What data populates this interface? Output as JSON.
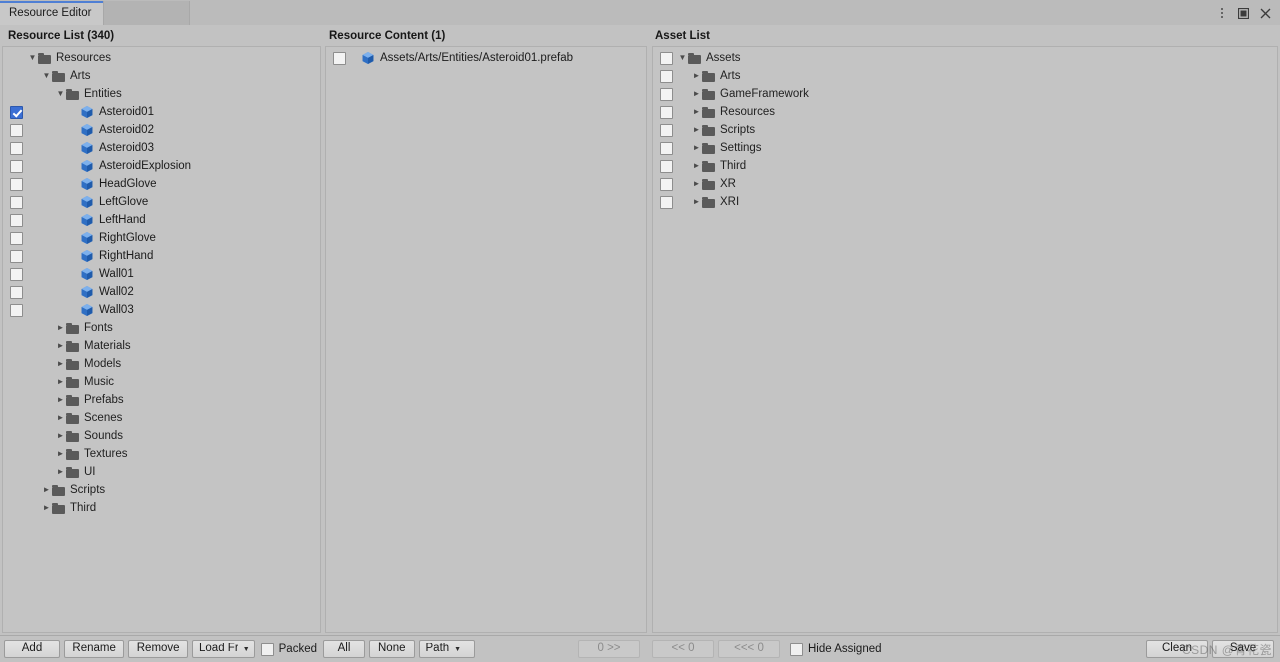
{
  "window": {
    "tab_label": "Resource Editor",
    "controls": {
      "menu": "kebab-menu-icon",
      "maximize": "maximize-icon",
      "close": "close-icon"
    }
  },
  "columns": {
    "resource_list_title": "Resource List (340)",
    "resource_content_title": "Resource Content (1)",
    "asset_list_title": "Asset List"
  },
  "resource_list": {
    "items": [
      {
        "label": "Resources",
        "type": "folder",
        "depth": 0,
        "expanded": true,
        "checkbox": "none"
      },
      {
        "label": "Arts",
        "type": "folder",
        "depth": 1,
        "expanded": true,
        "checkbox": "none"
      },
      {
        "label": "Entities",
        "type": "folder",
        "depth": 2,
        "expanded": true,
        "checkbox": "none"
      },
      {
        "label": "Asteroid01",
        "type": "prefab",
        "depth": 3,
        "expanded": null,
        "checkbox": "checked"
      },
      {
        "label": "Asteroid02",
        "type": "prefab",
        "depth": 3,
        "expanded": null,
        "checkbox": "unchecked"
      },
      {
        "label": "Asteroid03",
        "type": "prefab",
        "depth": 3,
        "expanded": null,
        "checkbox": "unchecked"
      },
      {
        "label": "AsteroidExplosion",
        "type": "prefab",
        "depth": 3,
        "expanded": null,
        "checkbox": "unchecked"
      },
      {
        "label": "HeadGlove",
        "type": "prefab",
        "depth": 3,
        "expanded": null,
        "checkbox": "unchecked"
      },
      {
        "label": "LeftGlove",
        "type": "prefab",
        "depth": 3,
        "expanded": null,
        "checkbox": "unchecked"
      },
      {
        "label": "LeftHand",
        "type": "prefab",
        "depth": 3,
        "expanded": null,
        "checkbox": "unchecked"
      },
      {
        "label": "RightGlove",
        "type": "prefab",
        "depth": 3,
        "expanded": null,
        "checkbox": "unchecked"
      },
      {
        "label": "RightHand",
        "type": "prefab",
        "depth": 3,
        "expanded": null,
        "checkbox": "unchecked"
      },
      {
        "label": "Wall01",
        "type": "prefab",
        "depth": 3,
        "expanded": null,
        "checkbox": "unchecked"
      },
      {
        "label": "Wall02",
        "type": "prefab",
        "depth": 3,
        "expanded": null,
        "checkbox": "unchecked"
      },
      {
        "label": "Wall03",
        "type": "prefab",
        "depth": 3,
        "expanded": null,
        "checkbox": "unchecked"
      },
      {
        "label": "Fonts",
        "type": "folder",
        "depth": 2,
        "expanded": false,
        "checkbox": "none"
      },
      {
        "label": "Materials",
        "type": "folder",
        "depth": 2,
        "expanded": false,
        "checkbox": "none"
      },
      {
        "label": "Models",
        "type": "folder",
        "depth": 2,
        "expanded": false,
        "checkbox": "none"
      },
      {
        "label": "Music",
        "type": "folder",
        "depth": 2,
        "expanded": false,
        "checkbox": "none"
      },
      {
        "label": "Prefabs",
        "type": "folder",
        "depth": 2,
        "expanded": false,
        "checkbox": "none"
      },
      {
        "label": "Scenes",
        "type": "folder",
        "depth": 2,
        "expanded": false,
        "checkbox": "none"
      },
      {
        "label": "Sounds",
        "type": "folder",
        "depth": 2,
        "expanded": false,
        "checkbox": "none"
      },
      {
        "label": "Textures",
        "type": "folder",
        "depth": 2,
        "expanded": false,
        "checkbox": "none"
      },
      {
        "label": "UI",
        "type": "folder",
        "depth": 2,
        "expanded": false,
        "checkbox": "none"
      },
      {
        "label": "Scripts",
        "type": "folder",
        "depth": 1,
        "expanded": false,
        "checkbox": "none"
      },
      {
        "label": "Third",
        "type": "folder",
        "depth": 1,
        "expanded": false,
        "checkbox": "none"
      }
    ]
  },
  "resource_content": {
    "items": [
      {
        "label": "Assets/Arts/Entities/Asteroid01.prefab",
        "type": "prefab",
        "depth": 0,
        "expanded": null,
        "checkbox": "unchecked"
      }
    ]
  },
  "asset_list": {
    "items": [
      {
        "label": "Assets",
        "type": "folder",
        "depth": 0,
        "expanded": true,
        "checkbox": "unchecked"
      },
      {
        "label": "Arts",
        "type": "folder",
        "depth": 1,
        "expanded": false,
        "checkbox": "unchecked"
      },
      {
        "label": "GameFramework",
        "type": "folder",
        "depth": 1,
        "expanded": false,
        "checkbox": "unchecked"
      },
      {
        "label": "Resources",
        "type": "folder",
        "depth": 1,
        "expanded": false,
        "checkbox": "unchecked"
      },
      {
        "label": "Scripts",
        "type": "folder",
        "depth": 1,
        "expanded": false,
        "checkbox": "unchecked"
      },
      {
        "label": "Settings",
        "type": "folder",
        "depth": 1,
        "expanded": false,
        "checkbox": "unchecked"
      },
      {
        "label": "Third",
        "type": "folder",
        "depth": 1,
        "expanded": false,
        "checkbox": "unchecked"
      },
      {
        "label": "XR",
        "type": "folder",
        "depth": 1,
        "expanded": false,
        "checkbox": "unchecked"
      },
      {
        "label": "XRI",
        "type": "folder",
        "depth": 1,
        "expanded": false,
        "checkbox": "unchecked"
      }
    ]
  },
  "toolbar": {
    "add_label": "Add",
    "rename_label": "Rename",
    "remove_label": "Remove",
    "load_from_label": "Load Fror",
    "packed_label": "Packed",
    "packed_checked": false,
    "all_label": "All",
    "none_label": "None",
    "path_label": "Path",
    "forward_label": "0 >>",
    "back_label": "<< 0",
    "back_all_label": "<<< 0",
    "hide_assigned_label": "Hide Assigned",
    "hide_assigned_checked": false,
    "clean_label": "Clean",
    "save_label": "Save"
  },
  "watermark": {
    "text": "CSDN @青花瓷"
  },
  "colors": {
    "accent": "#3b6fd4",
    "prefab_icon": "#3f7fd6",
    "folder_icon": "#5a5a5a",
    "panel_bg": "#c4c4c4",
    "window_bg": "#c2c2c2"
  }
}
